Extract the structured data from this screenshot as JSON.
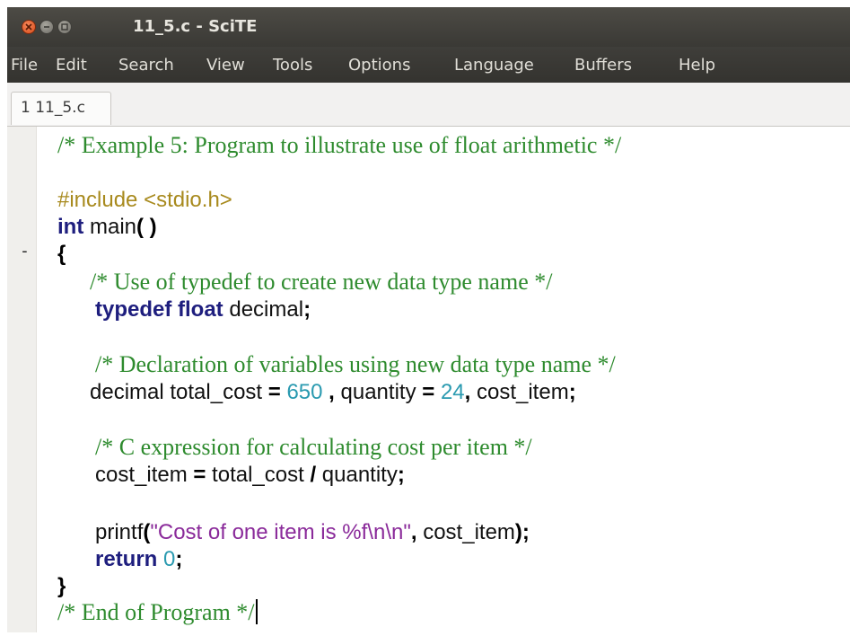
{
  "window": {
    "title": "11_5.c - SciTE"
  },
  "menubar": {
    "items": [
      "File",
      "Edit",
      "Search",
      "View",
      "Tools",
      "Options",
      "Language",
      "Buffers",
      "Help"
    ]
  },
  "tabs": [
    {
      "label": "1 11_5.c",
      "active": true
    }
  ],
  "code": {
    "l1": "/* Example 5: Program to illustrate use of float arithmetic */",
    "l2": "#include <stdio.h>",
    "l3_kw": "int",
    "l3_rest": " main",
    "l3_paren": "( )",
    "l4_fold": "-",
    "l4": "{",
    "l5": "/* Use of typedef to create new data type name */",
    "l6_kw": "typedef float",
    "l6_rest": " decimal",
    "l6_semi": ";",
    "l7": "/* Declaration of variables using new data type name */",
    "l8_a": "decimal total_cost ",
    "l8_eq1": "=",
    "l8_sp1": " ",
    "l8_n1": "650",
    "l8_sp2": " ",
    "l8_c1": ",",
    "l8_b": " quantity ",
    "l8_eq2": "=",
    "l8_sp3": " ",
    "l8_n2": "24",
    "l8_c2": ",",
    "l8_c": " cost_item",
    "l8_semi": ";",
    "l9": "/* C expression for calculating cost per item */",
    "l10_a": "cost_item ",
    "l10_eq": "=",
    "l10_b": " total_cost ",
    "l10_div": "/",
    "l10_c": " quantity",
    "l10_semi": ";",
    "l11_a": "printf",
    "l11_open": "(",
    "l11_str": "\"Cost of one item is %f\\n\\n\"",
    "l11_comma": ",",
    "l11_b": " cost_item",
    "l11_close": ");",
    "l12_kw": "return",
    "l12_sp": " ",
    "l12_n": "0",
    "l12_semi": ";",
    "l13": "}",
    "l14": "/* End of Program */"
  },
  "colors": {
    "titlebar": "#3a3935",
    "comment": "#2e8b2e",
    "keyword": "#1e1e7e",
    "preprocessor": "#a88a1e",
    "number": "#2a9ab0",
    "string": "#8a2a9a",
    "close_button": "#d94d1b"
  }
}
